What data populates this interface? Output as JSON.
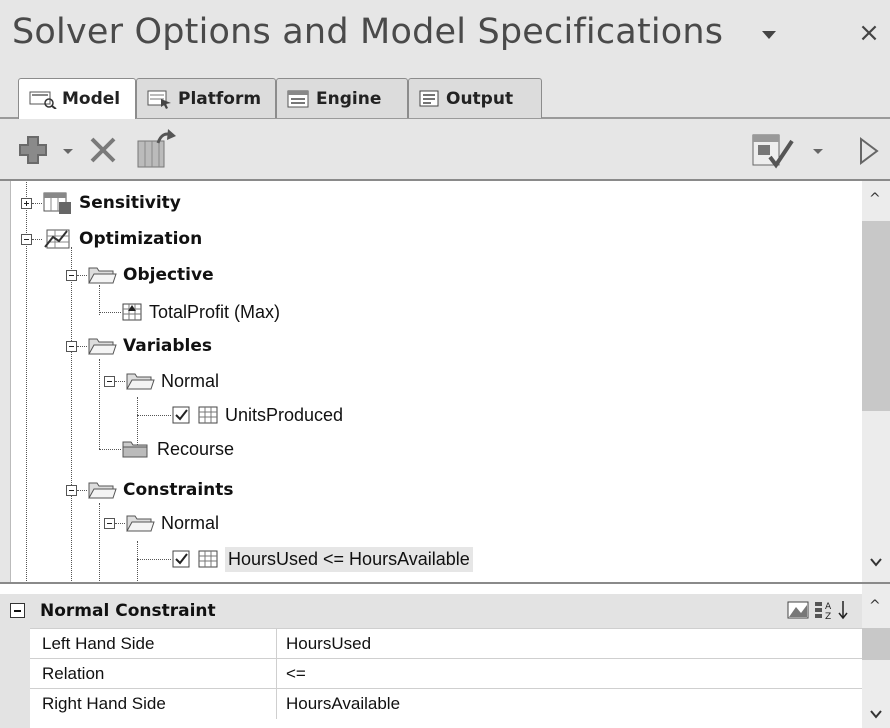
{
  "window": {
    "title": "Solver Options and Model Specifications",
    "dropdown_icon": "triangle-down",
    "close_label": "×"
  },
  "tabs": [
    {
      "label": "Model",
      "icon": "model-icon",
      "active": true
    },
    {
      "label": "Platform",
      "icon": "platform-icon",
      "active": false
    },
    {
      "label": "Engine",
      "icon": "engine-icon",
      "active": false
    },
    {
      "label": "Output",
      "icon": "output-icon",
      "active": false
    }
  ],
  "toolbar": {
    "add_icon": "plus-icon",
    "delete_icon": "delete-x-icon",
    "refresh_icon": "refresh-model-icon",
    "analyze_icon": "analyze-icon",
    "run_icon": "play-icon"
  },
  "tree": {
    "sensitivity": "Sensitivity",
    "optimization": "Optimization",
    "objective": "Objective",
    "objective_item": "TotalProfit (Max)",
    "variables": "Variables",
    "variables_normal": "Normal",
    "variables_item": "UnitsProduced",
    "recourse": "Recourse",
    "constraints": "Constraints",
    "constraints_normal": "Normal",
    "constraints_item": "HoursUsed <= HoursAvailable"
  },
  "properties": {
    "section_title": "Normal Constraint",
    "rows": [
      {
        "key": "Left Hand Side",
        "value": "HoursUsed"
      },
      {
        "key": "Relation",
        "value": "<="
      },
      {
        "key": "Right Hand Side",
        "value": "HoursAvailable"
      }
    ]
  },
  "colors": {
    "chrome_bg": "#e6e6e6",
    "selection_bg": "#e6e6e6",
    "border": "#8a8a8a"
  }
}
